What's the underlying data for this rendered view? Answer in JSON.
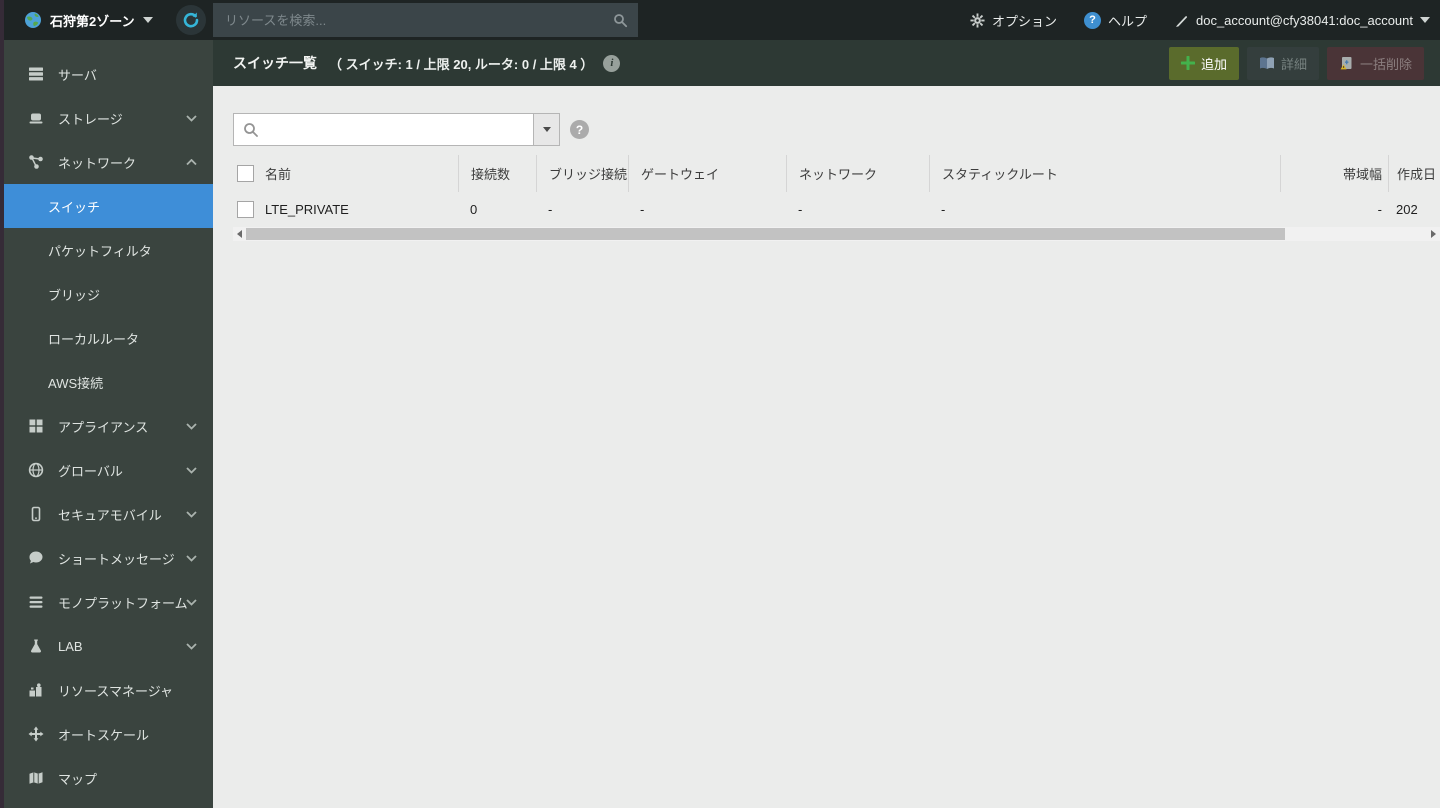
{
  "colors": {
    "accent_blue": "#3e8ed8",
    "topbar_bg": "#1e2424",
    "sidebar_bg": "#3a443f",
    "header_bg": "#2d3934",
    "add_button_bg": "#5a6b2c",
    "add_plus_green": "#43b14c",
    "delete_button_bg": "#4a3437",
    "help_badge_blue": "#3e8fd0",
    "refresh_cyan": "#35b5d8",
    "content_bg": "#ebeceb"
  },
  "icons": {
    "help_glyph": "?",
    "info_glyph": "i"
  },
  "topbar": {
    "zone_label": "石狩第2ゾーン",
    "search": {
      "placeholder": "リソースを検索..."
    },
    "options_label": "オプション",
    "help_label": "ヘルプ",
    "account_label": "doc_account@cfy38041:doc_account"
  },
  "sidebar": {
    "items": [
      {
        "label": "サーバ"
      },
      {
        "label": "ストレージ",
        "chevron": "down"
      },
      {
        "label": "ネットワーク",
        "chevron": "up",
        "expanded": true
      },
      {
        "label": "スイッチ",
        "sub": true,
        "selected": true
      },
      {
        "label": "パケットフィルタ",
        "sub": true
      },
      {
        "label": "ブリッジ",
        "sub": true
      },
      {
        "label": "ローカルルータ",
        "sub": true
      },
      {
        "label": "AWS接続",
        "sub": true
      },
      {
        "label": "アプライアンス",
        "chevron": "down"
      },
      {
        "label": "グローバル",
        "chevron": "down"
      },
      {
        "label": "セキュアモバイル",
        "chevron": "down"
      },
      {
        "label": "ショートメッセージ",
        "chevron": "down"
      },
      {
        "label": "モノプラットフォーム",
        "chevron": "down"
      },
      {
        "label": "LAB",
        "chevron": "down"
      },
      {
        "label": "リソースマネージャ"
      },
      {
        "label": "オートスケール"
      },
      {
        "label": "マップ"
      }
    ]
  },
  "page_header": {
    "title": "スイッチ一覧",
    "summary": "（ スイッチ: 1 / 上限 20, ルータ: 0 / 上限 4 ）",
    "buttons": {
      "add": "追加",
      "detail": "詳細",
      "bulk_delete": "一括削除"
    }
  },
  "content": {
    "search": {
      "value": ""
    },
    "table": {
      "headers": [
        "名前",
        "接続数",
        "ブリッジ接続",
        "ゲートウェイ",
        "ネットワーク",
        "スタティックルート",
        "帯域幅",
        "作成日"
      ],
      "rows": [
        [
          "LTE_PRIVATE",
          "0",
          "-",
          "-",
          "-",
          "-",
          "-",
          "202"
        ]
      ]
    }
  }
}
